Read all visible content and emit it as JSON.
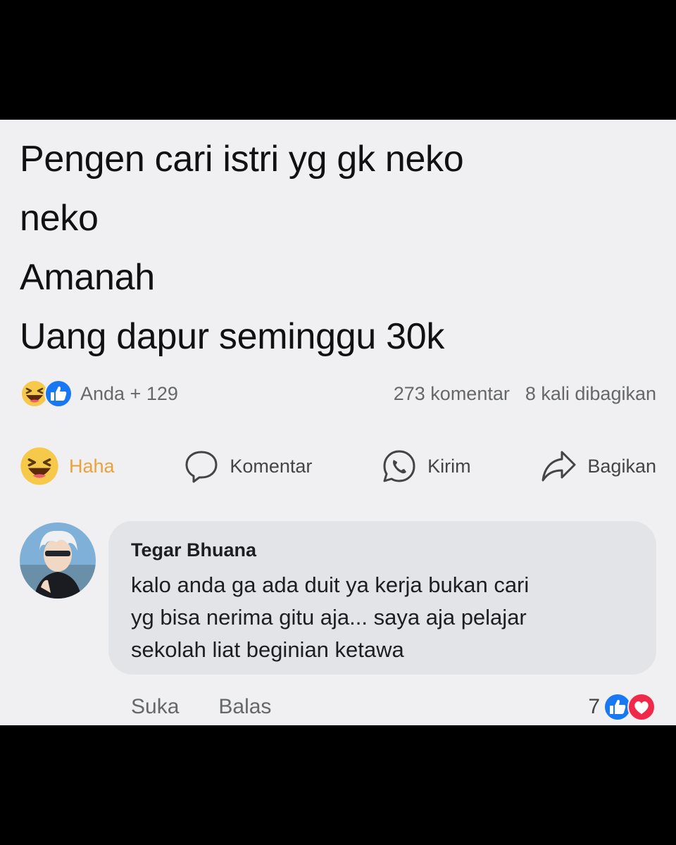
{
  "post": {
    "lines": [
      "Pengen cari istri yg gk neko",
      "neko",
      "Amanah",
      "Uang dapur seminggu 30k"
    ]
  },
  "stats": {
    "reactors": "Anda + 129",
    "comments": "273 komentar",
    "shares": "8 kali dibagikan",
    "reaction_icons": [
      "haha-icon",
      "like-icon"
    ]
  },
  "actions": {
    "haha": "Haha",
    "comment": "Komentar",
    "send": "Kirim",
    "share": "Bagikan"
  },
  "comment": {
    "author": "Tegar Bhuana",
    "lines": [
      "kalo anda ga ada duit ya kerja bukan cari",
      "yg bisa nerima gitu aja... saya aja pelajar",
      "sekolah liat beginian ketawa"
    ],
    "like_label": "Suka",
    "reply_label": "Balas",
    "reaction_count": "7",
    "reaction_icons": [
      "like-icon",
      "love-icon"
    ]
  },
  "colors": {
    "background": "#f0f0f2",
    "bubble": "#e3e4e8",
    "like_blue": "#1877f2",
    "love_red": "#f0284a",
    "haha_yellow": "#f7c94b",
    "haha_label": "#e8a33c"
  }
}
